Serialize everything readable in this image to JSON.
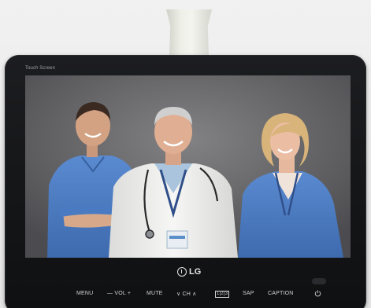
{
  "device": {
    "touch_label": "Touch Screen",
    "brand": "LG"
  },
  "controls": {
    "menu": "MENU",
    "vol": "— VOL +",
    "mute": "MUTE",
    "ch": "∨ CH ∧",
    "cc": "1|2|3",
    "sap": "SAP",
    "caption": "CAPTION"
  },
  "colors": {
    "bezel": "#141517",
    "scrubs_blue": "#4a7bc2",
    "coat_white": "#f1f1ef",
    "backdrop": "#66666a"
  },
  "icons": {
    "power": "power-icon",
    "logo": "lg-logo-icon"
  }
}
